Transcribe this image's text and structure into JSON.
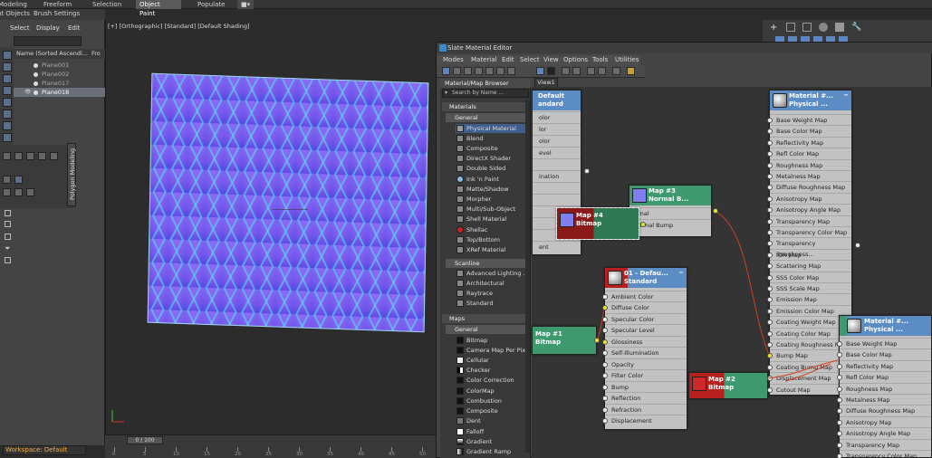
{
  "ribbon": {
    "tabs": [
      "Modeling",
      "Freeform",
      "Selection",
      "Object Paint",
      "Populate"
    ],
    "active": "Object Paint",
    "sub": [
      "nt Objects",
      "Brush Settings"
    ]
  },
  "explorer": {
    "menu": [
      "Select",
      "Display",
      "Edit"
    ],
    "header": "Name (Sorted Ascendi...",
    "header_right": "Fro",
    "items": [
      "Plane001",
      "Plane002",
      "Plane017",
      "Plane018"
    ],
    "selected": "Plane018"
  },
  "poly_tab": "Polygon Modeling",
  "viewport": {
    "label": "[+] [Orthographic] [Standard] [Default Shading]"
  },
  "timeline": {
    "slider": "0 / 100",
    "ticks": [
      "0",
      "5",
      "10",
      "15",
      "20",
      "25",
      "30",
      "35",
      "40",
      "45",
      "50"
    ]
  },
  "status": {
    "workspace": "Workspace: Default"
  },
  "sme": {
    "title": "Slate Material Editor",
    "menu": [
      "Modes",
      "Material",
      "Edit",
      "Select",
      "View",
      "Options",
      "Tools",
      "Utilities"
    ],
    "view_tab": "View1"
  },
  "browser": {
    "title": "Material/Map Browser",
    "search_placeholder": "Search by Name ...",
    "sections": {
      "materials": "Materials",
      "general": "General",
      "scanline": "Scanline",
      "maps": "Maps",
      "maps_general": "General"
    },
    "materials_general": [
      "Physical Material",
      "Blend",
      "Composite",
      "DirectX Shader",
      "Double Sided",
      "Ink 'n Paint",
      "Matte/Shadow",
      "Morpher",
      "Multi/Sub-Object",
      "Shell Material",
      "Shellac",
      "Top/Bottom",
      "XRef Material"
    ],
    "scanline": [
      "Advanced Lighting ...",
      "Architectural",
      "Raytrace",
      "Standard"
    ],
    "maps_general": [
      "Bitmap",
      "Camera Map Per Pixel",
      "Cellular",
      "Checker",
      "Color Correction",
      "ColorMap",
      "Combustion",
      "Composite",
      "Dent",
      "Falloff",
      "Gradient",
      "Gradient Ramp"
    ],
    "selected": "Physical Material"
  },
  "nodes": {
    "default_std": {
      "line1": "Default",
      "line2": "andard",
      "rows": [
        "olor",
        "lor",
        "olor",
        "evel",
        "",
        "ination",
        "",
        "",
        "",
        "",
        "",
        "",
        "ent"
      ]
    },
    "map3": {
      "line1": "Map #3",
      "line2": "Normal  B...",
      "rows": [
        "rmal",
        "itional Bump"
      ]
    },
    "map4": {
      "line1": "Map #4",
      "line2": "Bitmap"
    },
    "map1": {
      "line1": "Map #1",
      "line2": "Bitmap"
    },
    "map2": {
      "line1": "Map #2",
      "line2": "Bitmap"
    },
    "std01": {
      "line1": "01 - Defau...",
      "line2": "Standard",
      "rows": [
        "Ambient Color",
        "Diffuse Color",
        "Specular Color",
        "Specular Level",
        "Glossiness",
        "Self-Illumination",
        "Opacity",
        "Filter Color",
        "Bump",
        "Reflection",
        "Refraction",
        "Displacement"
      ]
    },
    "physical": {
      "line1": "Material #...",
      "line2": "Physical ...",
      "rows": [
        "Base Weight Map",
        "Base Color Map",
        "Reflectivity Map",
        "Refl Color Map",
        "Roughness Map",
        "Metalness Map",
        "Diffuse Roughness Map",
        "Anisotropy Map",
        "Anisotropy Angle Map",
        "Transparency Map",
        "Transparency Color Map",
        "Transparency Roughness...",
        "IOR Map",
        "Scattering Map",
        "SSS Color Map",
        "SSS Scale Map",
        "Emission Map",
        "Emission Color Map",
        "Coating Weight Map",
        "Coating Color Map",
        "Coating Roughness Map",
        "Bump Map",
        "Coating Bump Map",
        "Displacement Map",
        "Cutout Map"
      ]
    },
    "physical2": {
      "line1": "Material #...",
      "line2": "Physical ...",
      "rows": [
        "Base Weight Map",
        "Base Color Map",
        "Reflectivity Map",
        "Refl Color Map",
        "Roughness Map",
        "Metalness Map",
        "Diffuse Roughness Map",
        "Anisotropy Map",
        "Anisotropy Angle Map",
        "Transparency Map",
        "Transparency Color Map"
      ]
    }
  },
  "icons": {
    "normal_thumb": "#7f7ff0",
    "sphere_thumb": "#d8d8d8",
    "red_thumb": "#cc2a2a"
  }
}
